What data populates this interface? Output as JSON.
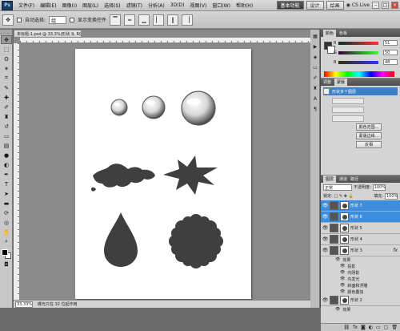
{
  "menubar": {
    "logo": "Ps",
    "items": [
      "文件(F)",
      "编辑(E)",
      "图像(I)",
      "图层(L)",
      "选择(S)",
      "滤镜(T)",
      "分析(A)",
      "3D(D)",
      "视图(V)",
      "窗口(W)",
      "帮助(H)"
    ],
    "zoom": "33.3",
    "workspaces": [
      "基本功能",
      "设计",
      "绘画"
    ],
    "cs_live": "CS Live",
    "win_min": "–",
    "win_max": "□",
    "win_close": "×"
  },
  "optbar": {
    "auto_select_label": "自动选择:",
    "auto_select_value": "组",
    "show_transform_label": "显示变换控件"
  },
  "document": {
    "tab_title": "未标题-1.psd @ 33.3%(形状 9, RGB/8)",
    "status_zoom": "33.33%",
    "status_text": "曝光只在 32 位起作用"
  },
  "panels": {
    "color_tabs": [
      "颜色",
      "色板"
    ],
    "sliders": [
      {
        "letter": "R",
        "value": "51"
      },
      {
        "letter": "G",
        "value": "50"
      },
      {
        "letter": "B",
        "value": "48"
      }
    ],
    "swatch_fg": "#333230",
    "swatch_bg": "#ffffff",
    "actions_tabs": [
      "调整",
      "蒙版"
    ],
    "actions_title": "形状多个图层",
    "actions_buttons": [
      "颜色范围...",
      "蒙版边缘...",
      "反相"
    ],
    "layers_tabs": [
      "图层",
      "通道",
      "路径"
    ],
    "blend_mode": "正常",
    "opacity_label": "不透明度:",
    "opacity_value": "100%",
    "fill_label": "填充:",
    "fill_value": "100%",
    "lock_label": "锁定:",
    "layers": [
      {
        "name": "形状 7",
        "selected": true
      },
      {
        "name": "形状 6",
        "selected": true
      },
      {
        "name": "形状 5",
        "selected": false
      },
      {
        "name": "形状 4",
        "selected": false
      },
      {
        "name": "形状 3",
        "selected": false
      }
    ],
    "effects_label": "效果",
    "effects": [
      "投影",
      "内阴影",
      "内发光",
      "斜面和浮雕",
      "颜色叠加"
    ],
    "layer_bottom": "形状 2",
    "effects_label2": "效果"
  },
  "colors": {
    "shape": "#3f3f3f",
    "page": "#ffffff",
    "selection": "#3c8ddc"
  }
}
